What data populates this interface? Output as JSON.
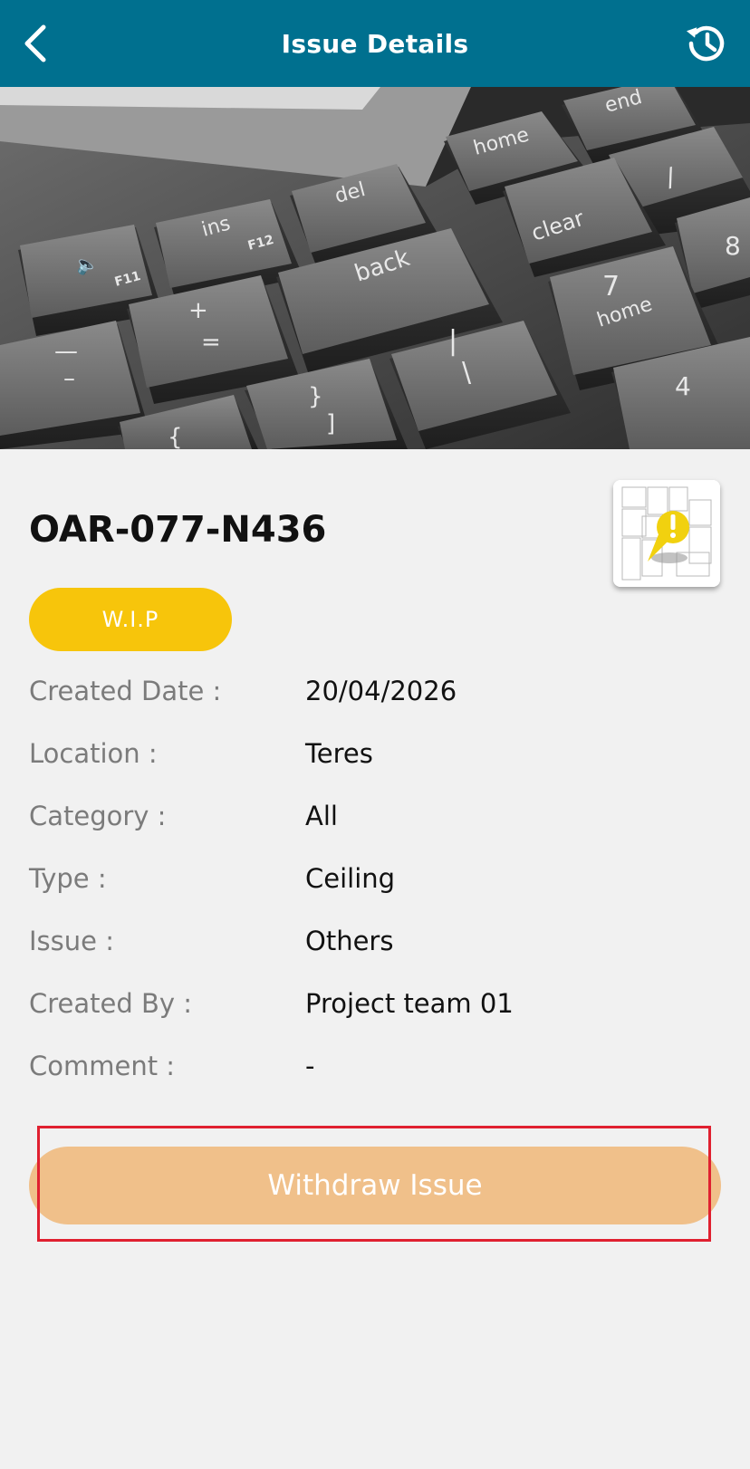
{
  "header": {
    "title": "Issue Details",
    "back_icon": "chevron-left-icon",
    "history_icon": "history-icon"
  },
  "photo": {
    "keys": {
      "volume": "F11",
      "ins": "ins",
      "f12": "F12",
      "del": "del",
      "back": "back",
      "home": "home",
      "end": "end",
      "clear": "clear",
      "seven": "7",
      "home2": "home",
      "four": "4",
      "eight": "8",
      "plus": "+",
      "equals": "=",
      "dash": "—",
      "underscore": "–",
      "brace_close": "}",
      "bracket_close": "]",
      "brace_open": "{",
      "slash": "/",
      "backslash": "\\",
      "pipe": "|"
    }
  },
  "issue": {
    "id": "OAR-077-N436",
    "status": "W.I.P",
    "status_color": "#f7c50b"
  },
  "details": [
    {
      "label": "Created Date :",
      "value": "20/04/2026"
    },
    {
      "label": "Location :",
      "value": "Teres"
    },
    {
      "label": "Category :",
      "value": "All"
    },
    {
      "label": "Type :",
      "value": "Ceiling"
    },
    {
      "label": "Issue :",
      "value": "Others"
    },
    {
      "label": "Created By :",
      "value": "Project team 01"
    },
    {
      "label": "Comment :",
      "value": "-"
    }
  ],
  "actions": {
    "withdraw_label": "Withdraw Issue",
    "withdraw_color": "#f0c08a"
  },
  "colors": {
    "header": "#00708f",
    "background": "#f1f1f1",
    "highlight": "#e02030"
  }
}
